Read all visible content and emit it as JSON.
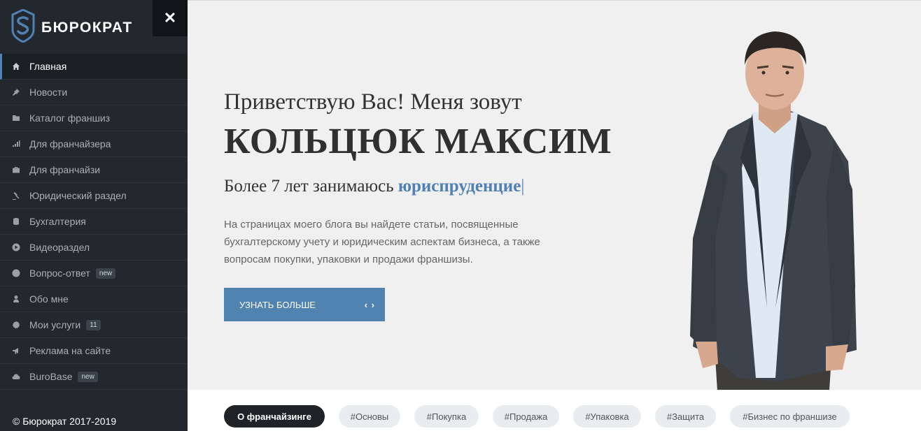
{
  "brand": {
    "name": "БЮРОКРАТ",
    "close_symbol": "✕"
  },
  "sidebar": {
    "items": [
      {
        "label": "Главная",
        "icon": "home-icon",
        "active": true
      },
      {
        "label": "Новости",
        "icon": "pin-icon"
      },
      {
        "label": "Каталог франшиз",
        "icon": "folder-icon"
      },
      {
        "label": "Для франчайзера",
        "icon": "bar-chart-icon"
      },
      {
        "label": "Для франчайзи",
        "icon": "briefcase-icon"
      },
      {
        "label": "Юридический раздел",
        "icon": "gavel-icon"
      },
      {
        "label": "Бухгалтерия",
        "icon": "coins-icon"
      },
      {
        "label": "Видеораздел",
        "icon": "play-circle-icon"
      },
      {
        "label": "Вопрос-ответ",
        "icon": "question-icon",
        "badge": "new"
      },
      {
        "label": "Обо мне",
        "icon": "user-icon"
      },
      {
        "label": "Мои услуги",
        "icon": "gear-icon",
        "badge": "11"
      },
      {
        "label": "Реклама на сайте",
        "icon": "bullhorn-icon"
      },
      {
        "label": "BuroBase",
        "icon": "cloud-icon",
        "badge": "new"
      }
    ],
    "copyright": "© Бюрократ 2017-2019"
  },
  "hero": {
    "greeting": "Приветствую Вас! Меня зовут",
    "name": "КОЛЬЦЮК МАКСИМ",
    "experience_prefix": "Более 7 лет занимаюсь ",
    "experience_highlight": "юриспруденцие",
    "experience_cursor": "|",
    "description": "На страницах моего блога вы найдете статьи, посвященные бухгалтерскому учету и юридическим аспектам бизнеса, а также вопросам покупки, упаковки и продажи франшизы.",
    "cta_label": "УЗНАТЬ БОЛЬШЕ",
    "cta_icon": "‹ ›"
  },
  "tags": [
    {
      "label": "О франчайзинге",
      "primary": true
    },
    {
      "label": "#Основы"
    },
    {
      "label": "#Покупка"
    },
    {
      "label": "#Продажа"
    },
    {
      "label": "#Упаковка"
    },
    {
      "label": "#Защита"
    },
    {
      "label": "#Бизнес по франшизе"
    }
  ],
  "colors": {
    "sidebar_bg": "#22282e",
    "accent": "#5183b0",
    "highlight_text": "#4f81b4",
    "hero_bg": "#f0f0f0"
  }
}
